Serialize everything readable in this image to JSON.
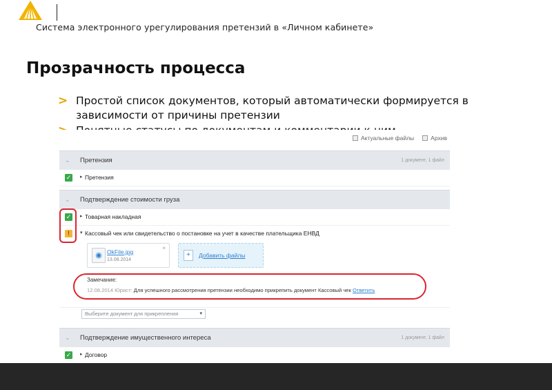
{
  "header": {
    "logo_icon": "stylized-roof-logo",
    "system_title": "Система электронного урегулирования претензий в «Личном кабинете»"
  },
  "slide": {
    "title": "Прозрачность процесса",
    "bullets": [
      {
        "text": "Простой список документов, который автоматически формируется в зависимости от причины претензии"
      },
      {
        "text": "Понятные статусы по документам и комментарии к ним"
      }
    ],
    "bullet_icon": "chevron-right",
    "bullet_color": "#e3a500"
  },
  "screenshot": {
    "tabs": [
      {
        "label": "Актуальные файлы",
        "icon": "files-icon"
      },
      {
        "label": "Архив",
        "icon": "archive-icon"
      }
    ],
    "sections": [
      {
        "title": "Претензия",
        "count": "1 документ, 1 файл",
        "rows": [
          {
            "status": "ok",
            "label": "Претензия"
          }
        ]
      },
      {
        "title": "Подтверждение стоимости груза",
        "count": "",
        "rows": [
          {
            "status": "ok",
            "label": "Товарная накладная"
          },
          {
            "status": "warning",
            "label": "Кассовый чек или свидетельство о постановке на учет в качестве плательщика ЕНВД"
          }
        ]
      },
      {
        "title": "Подтверждение имущественного интереса",
        "count": "1 документ, 1 файл",
        "rows": [
          {
            "status": "ok",
            "label": "Договор"
          }
        ]
      }
    ],
    "file": {
      "name": "OkFile.jpg",
      "date": "13.08.2014",
      "icon": "image-file-icon",
      "close": "×"
    },
    "add_files_label": "Добавить файлы",
    "comment": {
      "label": "Замечание:",
      "date": "12.08.2014",
      "role": "Юрист:",
      "text": "Для успешного рассмотрения претензии необходимо прикрепить документ Кассовый чек",
      "reply_label": "Ответить"
    },
    "attach_select": {
      "placeholder": "Выберите документ для прикрепления"
    },
    "highlight_color": "#d9252f"
  }
}
